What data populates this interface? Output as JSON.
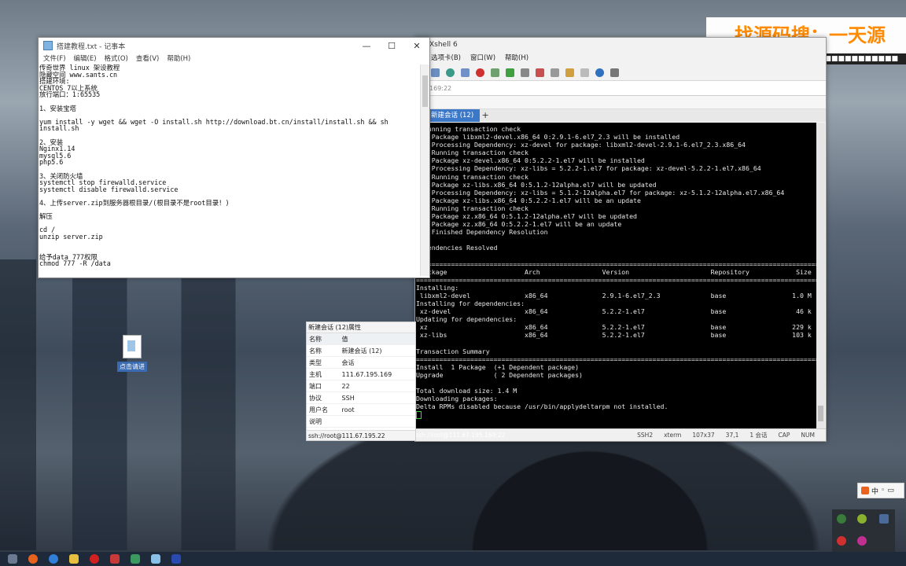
{
  "watermark": {
    "text": "找源码搜：一天源"
  },
  "notepad": {
    "title": "搭建教程.txt - 记事本",
    "controls": [
      "—",
      "☐",
      "✕"
    ],
    "menu": [
      "文件(F)",
      "编辑(E)",
      "格式(O)",
      "查看(V)",
      "帮助(H)"
    ],
    "text": "传奇世界 linux 架设教程\n隐藏空间 www.sants.cn\n搭建环境:\nCENTOS 7以上系统\n放行端口：1:65535\n\n1、安装宝塔\n\nyum install -y wget && wget -O install.sh http://download.bt.cn/install/install.sh && sh\ninstall.sh\n\n2、安装\nNginx1.14\nmysql5.6\nphp5.6\n\n3、关闭防火墙\nsystemctl stop firewalld.service\nsystemctl disable firewalld.service\n\n4、上传server.zip到服务器根目录/(根目录不是root目录！)\n\n解压\n\ncd /\nunzip server.zip\n\n\n给予data 777权限\nchmod 777 -R /data"
  },
  "xshell": {
    "title": "Xshell 6",
    "menu": [
      "选项卡(B)",
      "窗口(W)",
      "帮助(H)"
    ],
    "address": "169:22",
    "tab_label": "新建会话 (12)",
    "tab_plus": "+",
    "terminal": "  Running transaction check\n--> Package libxml2-devel.x86_64 0:2.9.1-6.el7_2.3 will be installed\n--> Processing Dependency: xz-devel for package: libxml2-devel-2.9.1-6.el7_2.3.x86_64\n--> Running transaction check\n--> Package xz-devel.x86_64 0:5.2.2-1.el7 will be installed\n--> Processing Dependency: xz-libs = 5.2.2-1.el7 for package: xz-devel-5.2.2-1.el7.x86_64\n--> Running transaction check\n--> Package xz-libs.x86_64 0:5.1.2-12alpha.el7 will be updated\n--> Processing Dependency: xz-libs = 5.1.2-12alpha.el7 for package: xz-5.1.2-12alpha.el7.x86_64\n--> Package xz-libs.x86_64 0:5.2.2-1.el7 will be an update\n--> Running transaction check\n--> Package xz.x86_64 0:5.1.2-12alpha.el7 will be updated\n--> Package xz.x86_64 0:5.2.2-1.el7 will be an update\n--> Finished Dependency Resolution\n\nDependencies Resolved\n\n=========================================================================================================\n Package                    Arch                Version                     Repository            Size\n=========================================================================================================\nInstalling:\n libxml2-devel              x86_64              2.9.1-6.el7_2.3             base                 1.0 M\nInstalling for dependencies:\n xz-devel                   x86_64              5.2.2-1.el7                 base                  46 k\nUpdating for dependencies:\n xz                         x86_64              5.2.2-1.el7                 base                 229 k\n xz-libs                    x86_64              5.2.2-1.el7                 base                 103 k\n\nTransaction Summary\n=========================================================================================================\nInstall  1 Package  (+1 Dependent package)\nUpgrade             ( 2 Dependent packages)\n\nTotal download size: 1.4 M\nDownloading packages:\nDelta RPMs disabled because /usr/bin/applydeltarpm not installed.",
    "status": {
      "address": "ssh://root@111.67.195.169:22",
      "protocol": "SSH2",
      "term": "xterm",
      "size": "107x37",
      "pos": "37,1",
      "sessions": "1 会话",
      "caps": "CAP",
      "num": "NUM"
    }
  },
  "props": {
    "header": "新建会话 (12)属性",
    "col_name": "名称",
    "col_value": "值",
    "rows": [
      {
        "k": "名称",
        "v": "新建会话 (12)"
      },
      {
        "k": "类型",
        "v": "会话"
      },
      {
        "k": "主机",
        "v": "111.67.195.169"
      },
      {
        "k": "端口",
        "v": "22"
      },
      {
        "k": "协议",
        "v": "SSH"
      },
      {
        "k": "用户名",
        "v": "root"
      },
      {
        "k": "说明",
        "v": ""
      }
    ],
    "footer": "ssh://root@111.67.195.22"
  },
  "desktop": {
    "icon_label": "点击请进"
  },
  "ime": {
    "label": "中"
  },
  "taskbar": {
    "apps": [
      "start-icon",
      "sogou-icon",
      "browser-icon",
      "explorer-icon",
      "netease-music-icon",
      "wps-icon",
      "network-icon",
      "notepad-icon",
      "xshell-icon"
    ]
  }
}
